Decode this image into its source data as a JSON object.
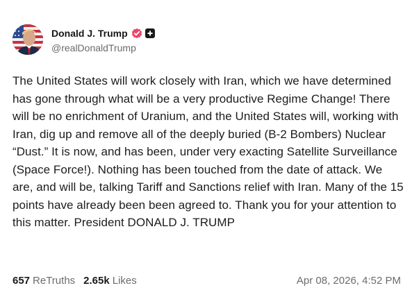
{
  "author": {
    "display_name": "Donald J. Trump",
    "handle": "@realDonaldTrump",
    "avatar_icon": "avatar-portrait-flag",
    "verified_icon": "verified-badge-icon",
    "verified_color": "#e8476e",
    "badge_icon": "plus-badge-icon"
  },
  "post": {
    "text": "The United States will work closely with Iran, which we have determined has gone through what will be a very productive Regime Change! There will be no enrichment of Uranium, and the United States will, working with Iran, dig up and remove all of the deeply buried (B-2 Bombers) Nuclear “Dust.” It is now, and has been, under very exacting Satellite Surveillance (Space Force!). Nothing has been touched from the date of attack. We are, and will be, talking Tariff and Sanctions relief with Iran. Many of the 15 points have already been been agreed to. Thank you for your attention to this matter. President DONALD J. TRUMP",
    "retruths_count": "657",
    "retruths_label": "ReTruths",
    "likes_count": "2.65k",
    "likes_label": "Likes",
    "timestamp": "Apr 08, 2026, 4:52 PM"
  }
}
